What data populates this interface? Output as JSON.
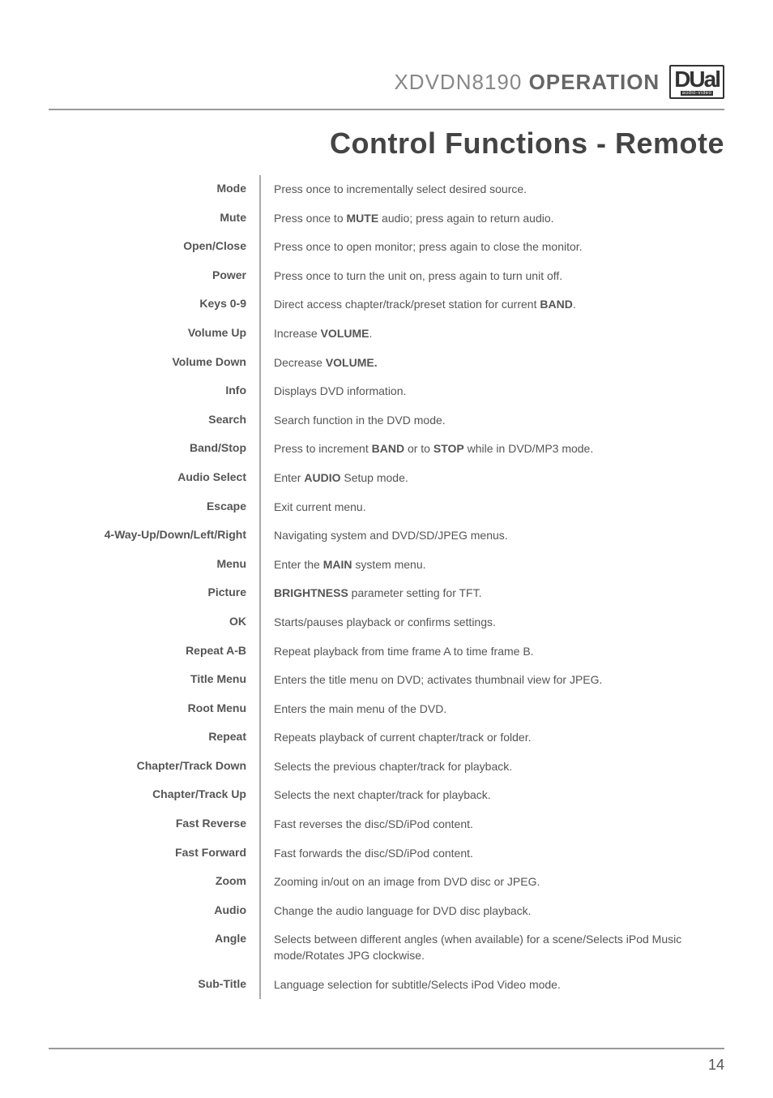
{
  "header": {
    "model": "XDVDN8190",
    "operation": "OPERATION",
    "logo": "DUal",
    "logoSub": "audio-video"
  },
  "pageTitle": "Control Functions - Remote",
  "rows": [
    {
      "label": "Mode",
      "desc": "Press once to incrementally select desired source."
    },
    {
      "label": "Mute",
      "desc": "Press once to <b>MUTE</b> audio; press again to return audio."
    },
    {
      "label": "Open/Close",
      "desc": "Press once to open monitor; press again to close the monitor."
    },
    {
      "label": "Power",
      "desc": "Press once to turn the unit on, press again to turn unit off."
    },
    {
      "label": "Keys 0-9",
      "desc": "Direct access chapter/track/preset station for current <b>BAND</b>."
    },
    {
      "label": "Volume Up",
      "desc": "Increase <b>VOLUME</b>."
    },
    {
      "label": "Volume Down",
      "desc": "Decrease <b>VOLUME.</b>"
    },
    {
      "label": "Info",
      "desc": "Displays DVD information."
    },
    {
      "label": "Search",
      "desc": "Search function in the DVD mode."
    },
    {
      "label": "Band/Stop",
      "desc": "Press to increment <b>BAND</b> or to <b>STOP</b> while in DVD/MP3 mode."
    },
    {
      "label": "Audio Select",
      "desc": "Enter <b>AUDIO</b> Setup mode."
    },
    {
      "label": "Escape",
      "desc": "Exit current menu."
    },
    {
      "label": "4-Way-Up/Down/Left/Right",
      "desc": "Navigating system and DVD/SD/JPEG menus."
    },
    {
      "label": "Menu",
      "desc": "Enter the <b>MAIN</b> system menu."
    },
    {
      "label": "Picture",
      "desc": "<b>BRIGHTNESS</b> parameter setting for TFT."
    },
    {
      "label": "OK",
      "desc": "Starts/pauses playback or confirms settings."
    },
    {
      "label": "Repeat A-B",
      "desc": "Repeat playback from time frame A to time frame B."
    },
    {
      "label": "Title Menu",
      "desc": "Enters the title menu on DVD; activates thumbnail view for JPEG."
    },
    {
      "label": "Root Menu",
      "desc": "Enters the main menu of the DVD."
    },
    {
      "label": "Repeat",
      "desc": "Repeats playback of current chapter/track or folder."
    },
    {
      "label": "Chapter/Track Down",
      "desc": "Selects the previous chapter/track for playback."
    },
    {
      "label": "Chapter/Track Up",
      "desc": "Selects the next chapter/track for playback."
    },
    {
      "label": "Fast Reverse",
      "desc": "Fast reverses the disc/SD/iPod content."
    },
    {
      "label": "Fast Forward",
      "desc": "Fast forwards the disc/SD/iPod content."
    },
    {
      "label": "Zoom",
      "desc": "Zooming in/out on an image from DVD disc or JPEG."
    },
    {
      "label": "Audio",
      "desc": "Change the audio language for DVD disc playback."
    },
    {
      "label": "Angle",
      "desc": "Selects between different angles (when available) for a scene/Selects iPod Music mode/Rotates JPG clockwise."
    },
    {
      "label": "Sub-Title",
      "desc": "Language selection for subtitle/Selects iPod Video mode."
    }
  ],
  "pageNumber": "14"
}
